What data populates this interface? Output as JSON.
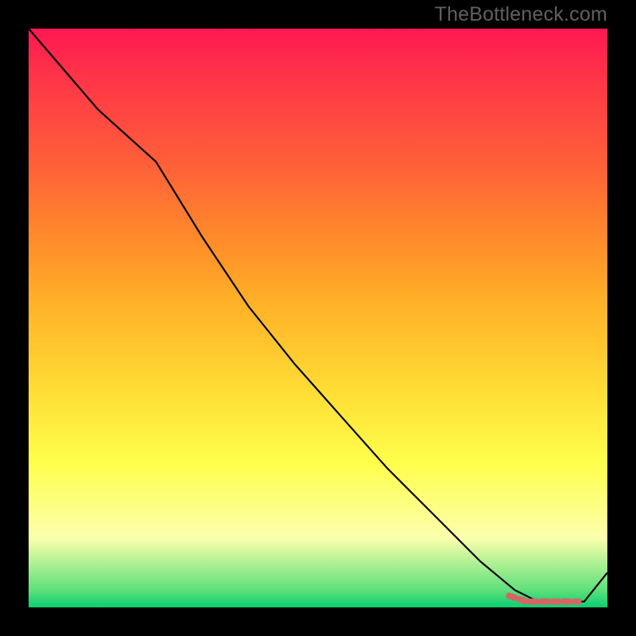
{
  "watermark": "TheBottleneck.com",
  "colors": {
    "background": "#000000",
    "curve": "#000000",
    "marker": "#d46666"
  },
  "chart_data": {
    "type": "line",
    "title": "",
    "xlabel": "",
    "ylabel": "",
    "xlim": [
      0,
      100
    ],
    "ylim": [
      0,
      100
    ],
    "grid": false,
    "legend": false,
    "comment": "Values read off the plot in relative 0–100 coordinates (left/bottom origin). Only the black curve and the dashed coral marker segment are visible; no axis ticks or labels are rendered in the image.",
    "series": [
      {
        "name": "main-curve",
        "x": [
          0,
          6,
          12,
          22,
          30,
          38,
          46,
          54,
          62,
          70,
          78,
          84,
          88,
          92,
          96,
          100
        ],
        "y": [
          100,
          93,
          86,
          77,
          64,
          52,
          42,
          33,
          24,
          16,
          8,
          3,
          1,
          1,
          1,
          6
        ]
      },
      {
        "name": "marker-segment",
        "x": [
          83,
          86,
          89,
          92,
          95
        ],
        "y": [
          2,
          1,
          1,
          1,
          1
        ]
      }
    ]
  }
}
